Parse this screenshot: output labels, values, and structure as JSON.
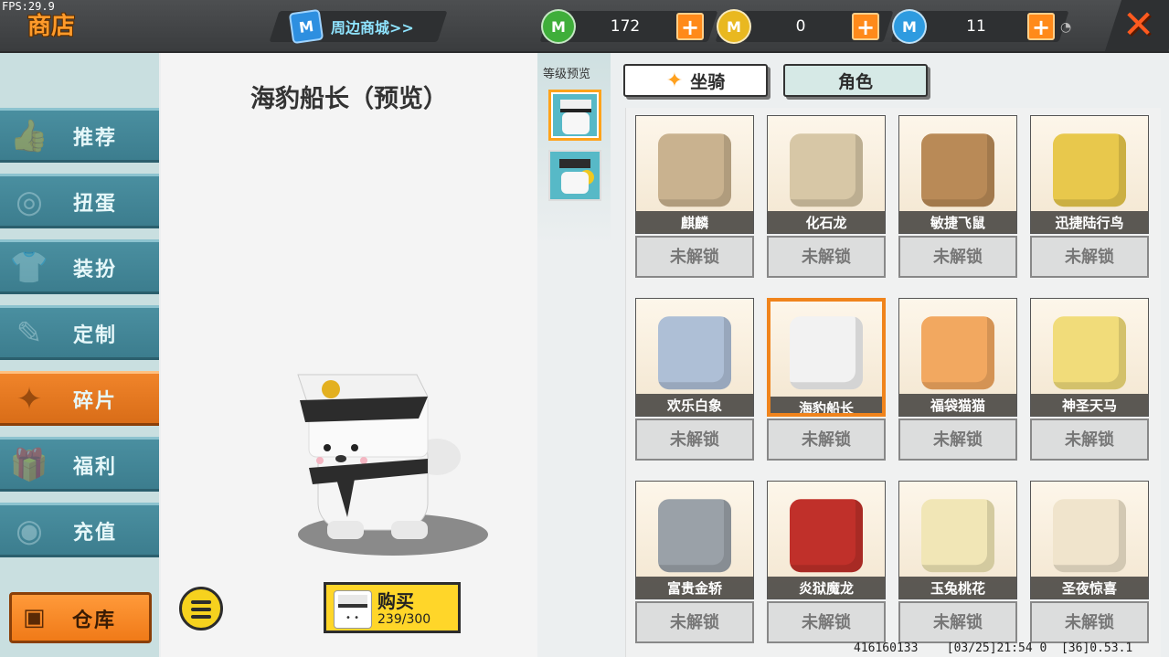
{
  "fps": "FPS:29.9",
  "header": {
    "title": "商店",
    "mall_link": "周边商城>>",
    "currencies": [
      {
        "icon": "green-gem-icon",
        "value": "172",
        "color": "#3fae3a",
        "glyph": "M"
      },
      {
        "icon": "gold-coin-icon",
        "value": "0",
        "color": "#e9b820",
        "glyph": "M"
      },
      {
        "icon": "blue-coin-icon",
        "value": "11",
        "color": "#2e9be0",
        "glyph": "M"
      }
    ]
  },
  "sidebar": {
    "items": [
      {
        "label": "推荐",
        "icon": "thumbs-up-icon",
        "glyph": "👍"
      },
      {
        "label": "扭蛋",
        "icon": "gacha-icon",
        "glyph": "◎"
      },
      {
        "label": "装扮",
        "icon": "shirt-icon",
        "glyph": "👕"
      },
      {
        "label": "定制",
        "icon": "pencil-icon",
        "glyph": "✎"
      },
      {
        "label": "碎片",
        "icon": "fragment-icon",
        "glyph": "✦"
      },
      {
        "label": "福利",
        "icon": "gift-icon",
        "glyph": "🎁"
      },
      {
        "label": "充值",
        "icon": "coins-icon",
        "glyph": "◉"
      }
    ],
    "active_index": 4,
    "warehouse_label": "仓库"
  },
  "preview": {
    "title": "海豹船长（预览）",
    "buy_label": "购买",
    "buy_count": "239/300"
  },
  "level_preview": {
    "label": "等级预览"
  },
  "tabs": [
    {
      "label": "坐骑",
      "active": false
    },
    {
      "label": "角色",
      "active": true
    }
  ],
  "cards": [
    {
      "name": "麒麟",
      "status": "未解锁",
      "color": "#c9b28f"
    },
    {
      "name": "化石龙",
      "status": "未解锁",
      "color": "#d7c7a6"
    },
    {
      "name": "敏捷飞鼠",
      "status": "未解锁",
      "color": "#b98a57"
    },
    {
      "name": "迅捷陆行鸟",
      "status": "未解锁",
      "color": "#e8c84c"
    },
    {
      "name": "欢乐白象",
      "status": "未解锁",
      "color": "#aebfd6"
    },
    {
      "name": "海豹船长",
      "status": "未解锁",
      "color": "#f2f2f2"
    },
    {
      "name": "福袋猫猫",
      "status": "未解锁",
      "color": "#f2a860"
    },
    {
      "name": "神圣天马",
      "status": "未解锁",
      "color": "#f1dc7a"
    },
    {
      "name": "富贵金轿",
      "status": "未解锁",
      "color": "#9aa1a8"
    },
    {
      "name": "炎狱魔龙",
      "status": "未解锁",
      "color": "#c0302a"
    },
    {
      "name": "玉兔桃花",
      "status": "未解锁",
      "color": "#f1e6b6"
    },
    {
      "name": "圣夜惊喜",
      "status": "未解锁",
      "color": "#f0e4cc"
    }
  ],
  "selected_card": 5,
  "footer": "416160133    [03/25]21:54 0  [36]0.53.1"
}
